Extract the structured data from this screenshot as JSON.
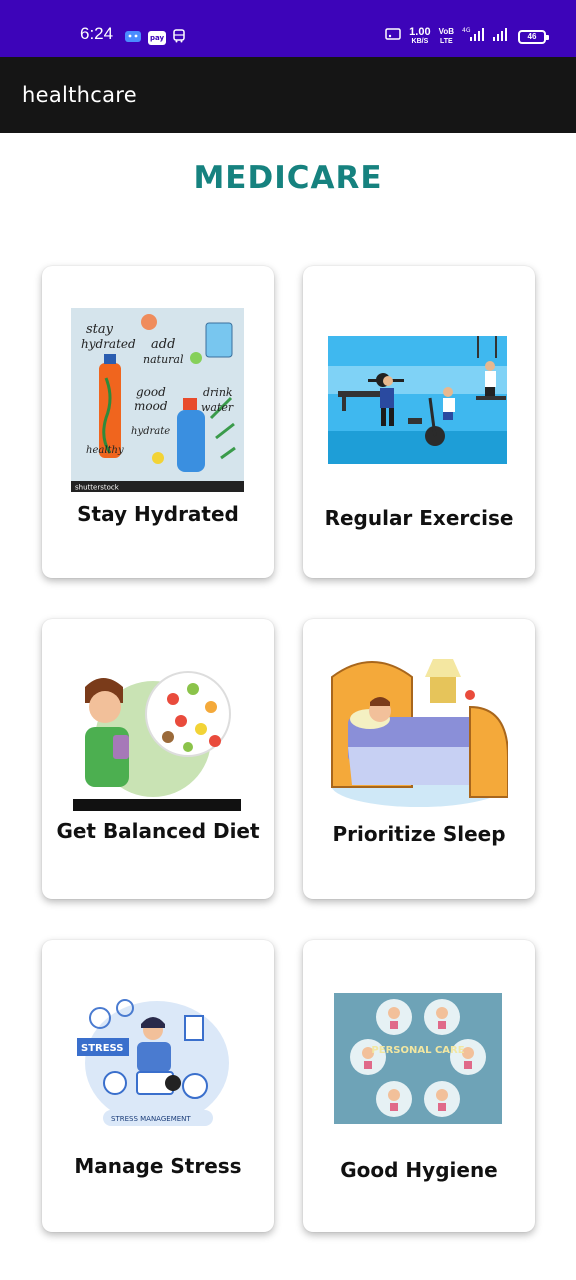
{
  "status_bar": {
    "time": "6:24",
    "network_speed": "1.00",
    "network_speed_unit": "KB/S",
    "volte": "VoB",
    "lte": "LTE",
    "network_type": "4G",
    "battery": "46"
  },
  "app_bar": {
    "title": "healthcare"
  },
  "page": {
    "title": "MEDICARE"
  },
  "cards": [
    {
      "label": "Stay Hydrated",
      "image_caption": "shutterstock"
    },
    {
      "label": "Regular Exercise"
    },
    {
      "label": "Get Balanced Diet"
    },
    {
      "label": "Prioritize Sleep"
    },
    {
      "label": "Manage Stress",
      "image_caption": "STRESS MANAGEMENT",
      "image_badge": "STRESS"
    },
    {
      "label": "Good Hygiene",
      "image_caption": "PERSONAL CARE"
    }
  ],
  "colors": {
    "status_bar": "#3d04b9",
    "app_bar": "#151515",
    "title": "#16827f"
  }
}
